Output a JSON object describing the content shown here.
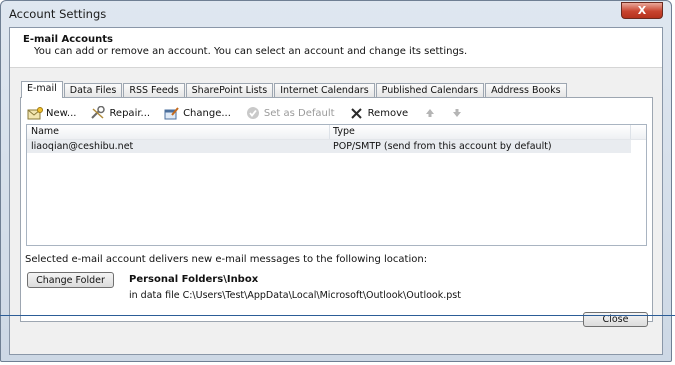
{
  "window": {
    "title": "Account Settings",
    "close_glyph": "X"
  },
  "header": {
    "title": "E-mail Accounts",
    "description": "You can add or remove an account. You can select an account and change its settings."
  },
  "tabs": [
    {
      "label": "E-mail"
    },
    {
      "label": "Data Files"
    },
    {
      "label": "RSS Feeds"
    },
    {
      "label": "SharePoint Lists"
    },
    {
      "label": "Internet Calendars"
    },
    {
      "label": "Published Calendars"
    },
    {
      "label": "Address Books"
    }
  ],
  "toolbar": {
    "new_label": "New...",
    "repair_label": "Repair...",
    "change_label": "Change...",
    "set_default_label": "Set as Default",
    "remove_label": "Remove"
  },
  "account_list": {
    "columns": [
      "Name",
      "Type"
    ],
    "rows": [
      {
        "name": "liaoqian@ceshibu.net",
        "type": "POP/SMTP (send from this account by default)"
      }
    ]
  },
  "delivery": {
    "text": "Selected e-mail account delivers new e-mail messages to the following location:",
    "change_folder_label": "Change Folder",
    "folder_name": "Personal Folders\\Inbox",
    "folder_path": "in data file C:\\Users\\Test\\AppData\\Local\\Microsoft\\Outlook\\Outlook.pst"
  },
  "footer": {
    "close_label": "Close"
  },
  "colors": {
    "accent": "#2c5d97",
    "close_red": "#c8442f",
    "row_highlight": "#e9ecf0"
  },
  "icons": [
    "new-mail-icon",
    "repair-icon",
    "change-icon",
    "set-default-icon",
    "remove-icon",
    "move-up-icon",
    "move-down-icon"
  ]
}
